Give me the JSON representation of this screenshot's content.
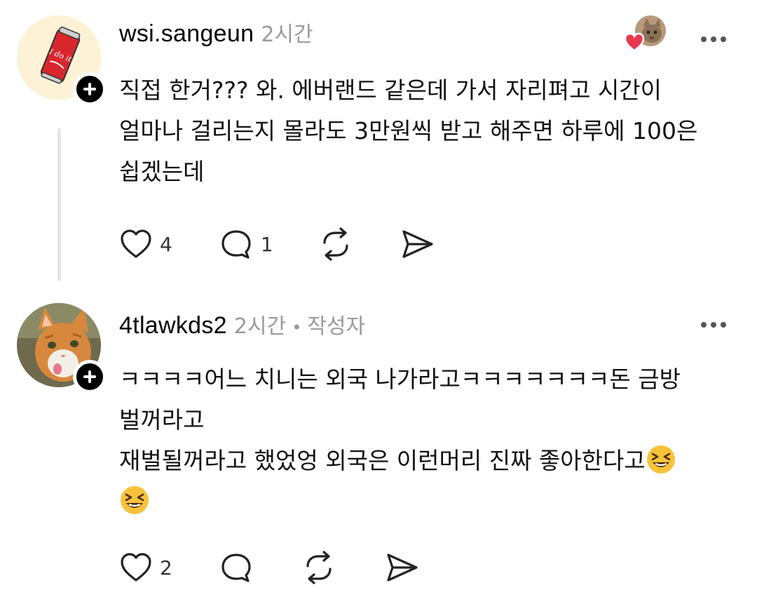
{
  "comments": [
    {
      "username": "wsi.sangeun",
      "time": "2시간",
      "lines": [
        "직접 한거??? 와. 에버랜드 같은데 가서 자리펴고 시간이",
        "얼마나 걸리는지 몰라도 3만원씩 받고 해주면 하루에 100은",
        "쉽겠는데"
      ],
      "likes": "4",
      "replies": "1",
      "avatar_icon": "soda-can-icon",
      "liked_by_icon": "cat-avatar-with-heart-icon"
    },
    {
      "username": "4tlawkds2",
      "time": "2시간",
      "author_badge": "작성자",
      "lines": [
        "ㅋㅋㅋㅋ어느 치니는 외국 나가라고ㅋㅋㅋㅋㅋㅋㅋ돈 금방",
        "벌꺼라고",
        "재벌될꺼라고 했었엉 외국은 이런머리 진짜 좋아한다고"
      ],
      "likes": "2",
      "avatar_icon": "orange-cat-icon",
      "emoji": "grinning-squinting-face-icon"
    }
  ],
  "colors": {
    "meta_gray": "#9a9a9a",
    "heart_red": "#e8384f",
    "emoji_yellow": "#f7c23a",
    "avatar_bg": "#fdf1d6"
  }
}
